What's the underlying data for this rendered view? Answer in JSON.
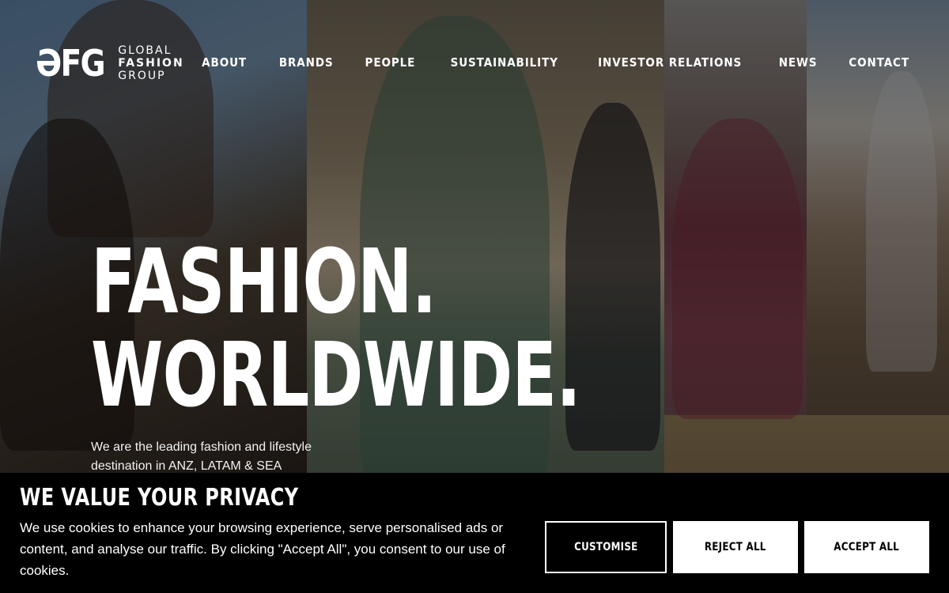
{
  "brand": {
    "mark": "ƏFG",
    "name_lines": [
      "GLOBAL",
      "FASHION",
      "GROUP"
    ]
  },
  "nav": {
    "items": [
      {
        "label": "ABOUT"
      },
      {
        "label": "BRANDS"
      },
      {
        "label": "PEOPLE"
      },
      {
        "label": "SUSTAINABILITY"
      },
      {
        "label": "INVESTOR RELATIONS"
      },
      {
        "label": "NEWS"
      },
      {
        "label": "CONTACT"
      }
    ]
  },
  "hero": {
    "title_line1": "FASHION.",
    "title_line2": "WORLDWIDE.",
    "subtitle": "We are the leading fashion and lifestyle destination in ANZ, LATAM & SEA"
  },
  "cookie_banner": {
    "title": "WE VALUE YOUR PRIVACY",
    "text": "We use cookies to enhance your browsing experience, serve personalised ads or content, and analyse our traffic. By clicking \"Accept All\", you consent to our use of cookies.",
    "buttons": {
      "customise": "CUSTOMISE",
      "reject": "REJECT ALL",
      "accept": "ACCEPT ALL"
    }
  },
  "colors": {
    "banner_bg": "#000000",
    "button_bg": "#ffffff",
    "text": "#ffffff"
  }
}
